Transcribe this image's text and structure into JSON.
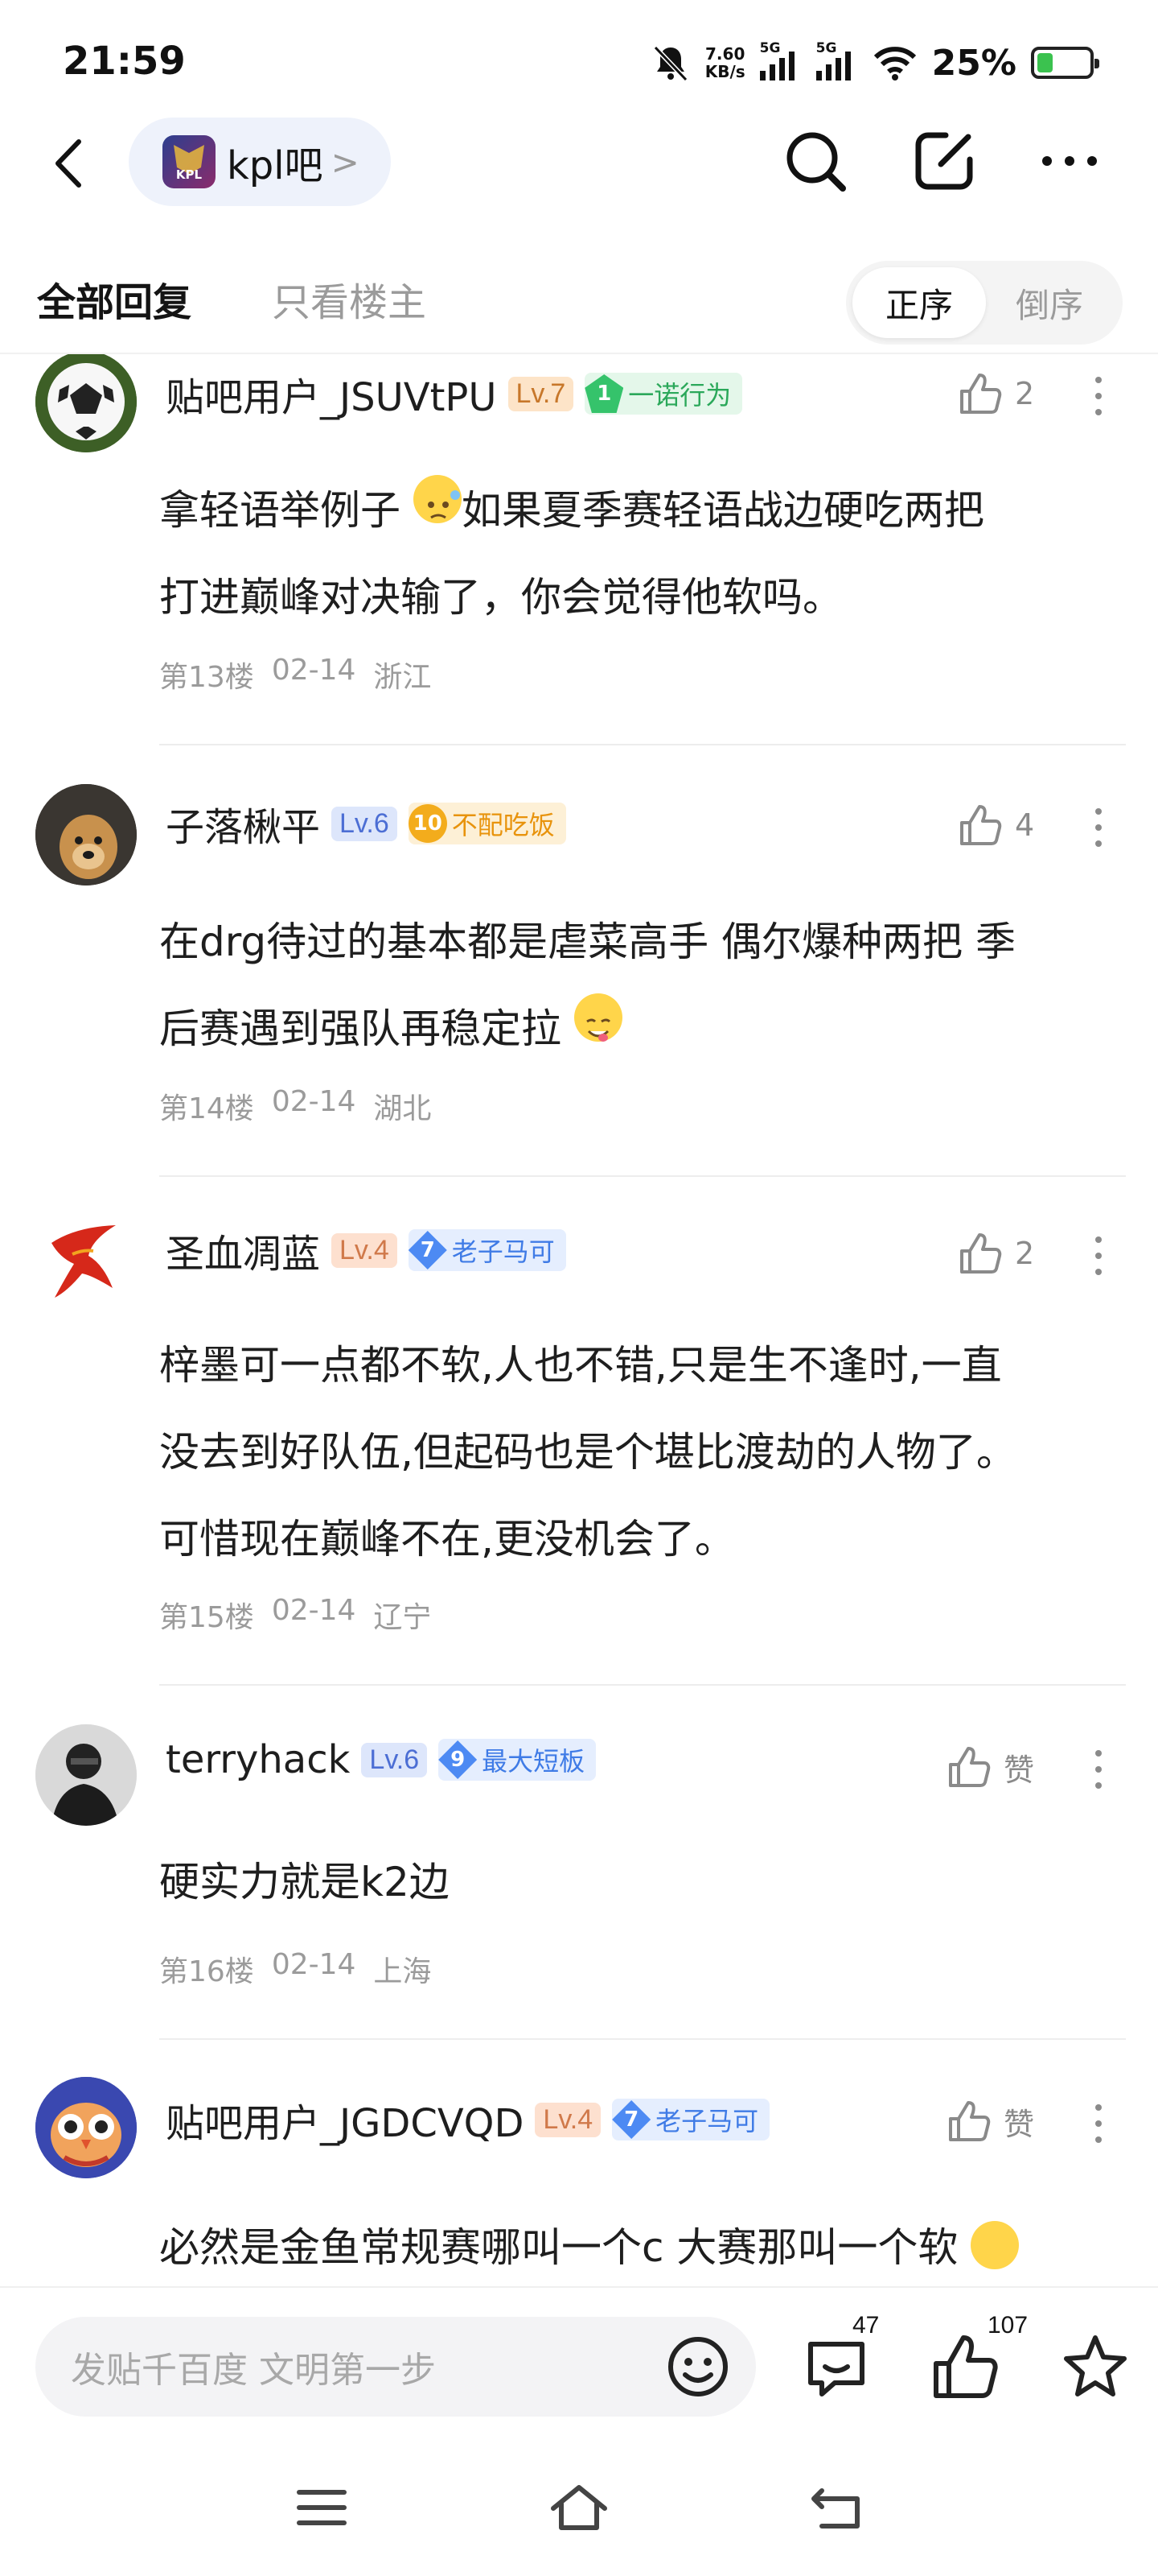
{
  "status_bar": {
    "time": "21:59",
    "speed_value": "7.60",
    "speed_unit": "KB/s",
    "sim1": "5G",
    "sim2": "5G",
    "battery": "25%"
  },
  "nav": {
    "forum_name": "kpl吧",
    "forum_logo_text": "KPL",
    "forum_chevron": ">",
    "icons": [
      "back-icon",
      "search-icon",
      "compose-icon",
      "more-icon"
    ]
  },
  "tabs": {
    "all_replies": "全部回复",
    "op_only": "只看楼主",
    "order_asc": "正序",
    "order_desc": "倒序"
  },
  "posts": [
    {
      "user": "贴吧用户_JSUVtPU",
      "level": "Lv.7",
      "badge_num": "1",
      "badge_text": "一诺行为",
      "likes": "2",
      "content": "拿轻语举例子 如果夏季赛轻语战边硬吃两把打进巅峰对决输了，你会觉得他软吗。",
      "content_a": "拿轻语举例子",
      "content_b": "如果夏季赛轻语战边硬吃两把",
      "content_c": "打进巅峰对决输了，你会觉得他软吗。",
      "floor": "第13楼",
      "date": "02-14",
      "location": "浙江"
    },
    {
      "user": "子落楸平",
      "level": "Lv.6",
      "badge_num": "10",
      "badge_text": "不配吃饭",
      "likes": "4",
      "content_a": "在drg待过的基本都是虐菜高手 偶尔爆种两把 季",
      "content_b": "后赛遇到强队再稳定拉",
      "floor": "第14楼",
      "date": "02-14",
      "location": "湖北"
    },
    {
      "user": "圣血凋蓝",
      "level": "Lv.4",
      "badge_num": "7",
      "badge_text": "老子马可",
      "likes": "2",
      "content_a": "梓墨可一点都不软,人也不错,只是生不逢时,一直",
      "content_b": "没去到好队伍,但起码也是个堪比渡劫的人物了。",
      "content_c": "可惜现在巅峰不在,更没机会了。",
      "floor": "第15楼",
      "date": "02-14",
      "location": "辽宁"
    },
    {
      "user": "terryhack",
      "level": "Lv.6",
      "badge_num": "9",
      "badge_text": "最大短板",
      "likes": "赞",
      "content_a": "硬实力就是k2边",
      "floor": "第16楼",
      "date": "02-14",
      "location": "上海"
    },
    {
      "user": "贴吧用户_JGDCVQD",
      "level": "Lv.4",
      "badge_num": "7",
      "badge_text": "老子马可",
      "likes": "赞",
      "content_a": "必然是金鱼常规赛哪叫一个c 大赛那叫一个软"
    }
  ],
  "bottom_bar": {
    "input_placeholder": "发贴千百度 文明第一步",
    "comment_count": "47",
    "like_count": "107"
  },
  "colors": {
    "accent_blue": "#4d8af3",
    "level_orange": "#c7772a",
    "badge_green": "#35c36b",
    "badge_gold": "#f3ac1c",
    "battery_green": "#3bc24f"
  }
}
